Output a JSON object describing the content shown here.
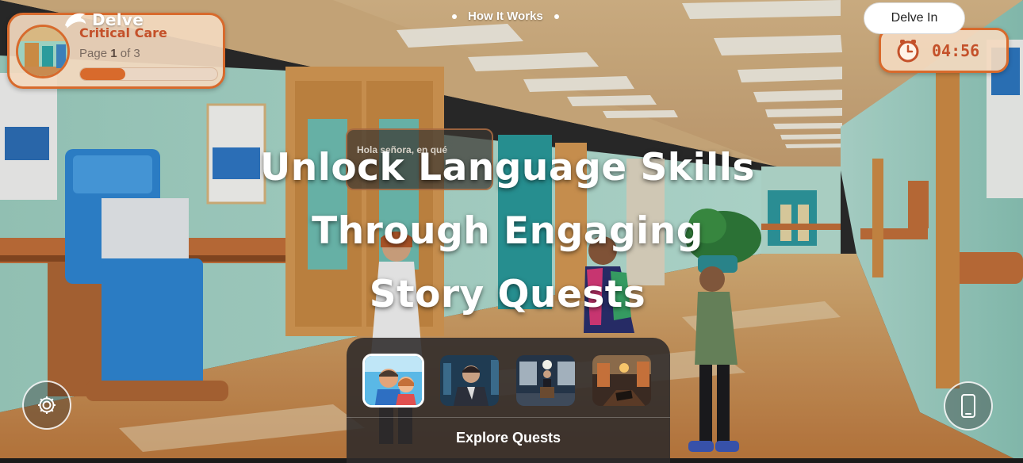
{
  "brand": {
    "name": "Delve",
    "logo_icon": "dolphin-icon"
  },
  "nav": {
    "links": [
      {
        "label": "How It Works"
      }
    ]
  },
  "auth": {
    "delve_in_label": "Delve In"
  },
  "story": {
    "title": "Critical Care",
    "page_label": "Page",
    "page_current": "1",
    "page_of": "of",
    "page_total": "3",
    "progress_fraction": 0.33
  },
  "timer": {
    "icon": "clock-icon",
    "value": "04:56"
  },
  "hero": {
    "lines": [
      "Unlock Language Skills",
      "Through Engaging",
      "Story Quests"
    ]
  },
  "bubble": {
    "text": "Hola señora, en qué"
  },
  "quests": {
    "items": [
      {
        "name": "quest-thumb-family",
        "active": true
      },
      {
        "name": "quest-thumb-man-city",
        "active": false
      },
      {
        "name": "quest-thumb-speaker-stage",
        "active": false
      },
      {
        "name": "quest-thumb-ancient-street",
        "active": false
      }
    ],
    "explore_label": "Explore Quests"
  },
  "buttons": {
    "settings_icon": "gear-icon",
    "device_icon": "mobile-phone-icon"
  },
  "colors": {
    "accent": "#d86a2c",
    "card_bg": "#f3d9bf",
    "panel_bg": "#2d2a2a",
    "wall": "#a9d6c8",
    "floor": "#c98f4f"
  }
}
